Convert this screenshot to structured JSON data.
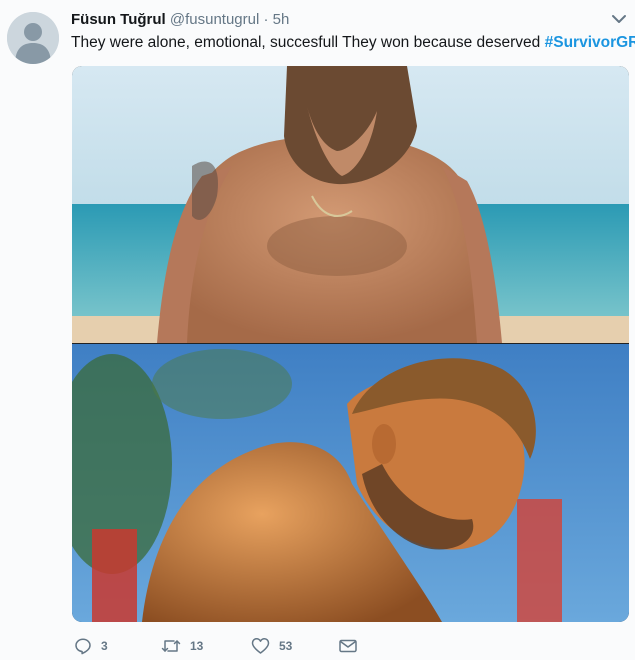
{
  "tweet": {
    "author_name": "Füsun Tuğrul",
    "author_handle": "@fusuntugrul",
    "separator": "·",
    "time": "5h",
    "text": "They were alone, emotional, succesfull They won because deserved",
    "hashtag": "#SurvivorGR"
  },
  "actions": {
    "reply_count": "3",
    "retweet_count": "13",
    "like_count": "53"
  },
  "icons": {
    "caret": "chevron-down-icon",
    "reply": "reply-icon",
    "retweet": "retweet-icon",
    "like": "heart-icon",
    "dm": "envelope-icon"
  },
  "colors": {
    "link": "#1b95e0",
    "secondary_text": "#657786",
    "avatar_bg": "#ccd6dd"
  }
}
